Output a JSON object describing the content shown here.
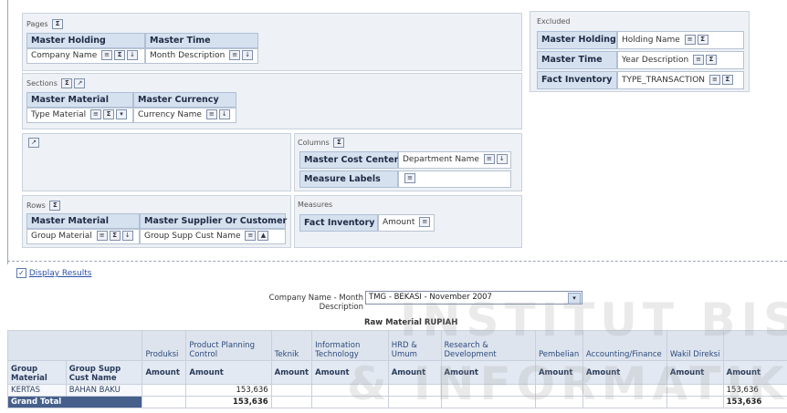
{
  "pages": {
    "label": "Pages",
    "headers": [
      "Master Holding",
      "Master Time"
    ],
    "items": [
      "Company Name",
      "Month Description"
    ]
  },
  "excluded": {
    "label": "Excluded",
    "rows": [
      {
        "header": "Master Holding",
        "value": "Holding Name"
      },
      {
        "header": "Master Time",
        "value": "Year Description"
      },
      {
        "header": "Fact Inventory",
        "value": "TYPE_TRANSACTION"
      }
    ]
  },
  "sections": {
    "label": "Sections",
    "headers": [
      "Master Material",
      "Master Currency"
    ],
    "items": [
      "Type Material",
      "Currency Name"
    ]
  },
  "columns": {
    "label": "Columns",
    "rows": [
      {
        "header": "Master Cost Center",
        "value": "Department Name"
      },
      {
        "header": "Measure Labels",
        "value": ""
      }
    ]
  },
  "rows": {
    "label": "Rows",
    "headers": [
      "Master Material",
      "Master Supplier Or Customer"
    ],
    "items": [
      "Group Material",
      "Group Supp Cust Name"
    ]
  },
  "measures": {
    "label": "Measures",
    "header": "Fact Inventory",
    "value": "Amount"
  },
  "display_results": {
    "label": "Display Results",
    "checked": true
  },
  "prompt": {
    "label": "Company Name - Month Description",
    "selected": "TMG - BEKASI - November 2007"
  },
  "results": {
    "caption": "Raw Material RUPIAH",
    "departments": [
      "Produksi",
      "Product Planning Control",
      "Teknik",
      "Information Technology",
      "HRD & Umum",
      "Research & Development",
      "Pembelian",
      "Accounting/Finance",
      "Wakil Direksi",
      ""
    ],
    "row_headers": [
      "Group Material",
      "Group Supp Cust Name"
    ],
    "measure": "Amount",
    "data_rows": [
      {
        "group_material": "KERTAS",
        "group_supp": "BAHAN BAKU",
        "ppc": "153,636",
        "last": "153,636"
      }
    ],
    "grand_total": {
      "label": "Grand Total",
      "ppc": "153,636",
      "last": "153,636"
    }
  },
  "watermark": {
    "line1": "INSTITUT BISNIS",
    "line2": "& INFORMATIKA"
  },
  "colors": {
    "header_bg": "#d6e1ef",
    "total_bg": "#465f8b",
    "pane_bg": "#eef1f5"
  }
}
